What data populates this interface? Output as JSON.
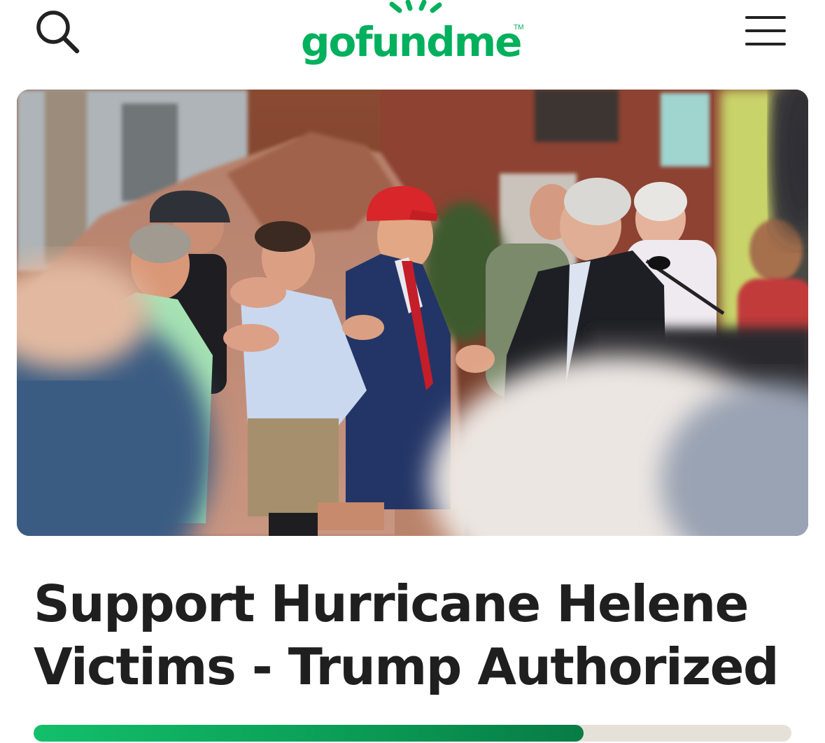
{
  "header": {
    "logo_text": "gofundme",
    "logo_tm": "TM",
    "search_icon": "search-icon",
    "menu_icon": "hamburger-menu-icon"
  },
  "campaign": {
    "title_line1": "Support Hurricane Helene",
    "title_line2": "Victims - Trump Authorized",
    "progress_fraction": 0.726
  },
  "colors": {
    "brand_green": "#00b05c",
    "progress_fill": "#0a9b55",
    "progress_track": "#e6e1d8",
    "title_text": "#1f1f1f"
  }
}
